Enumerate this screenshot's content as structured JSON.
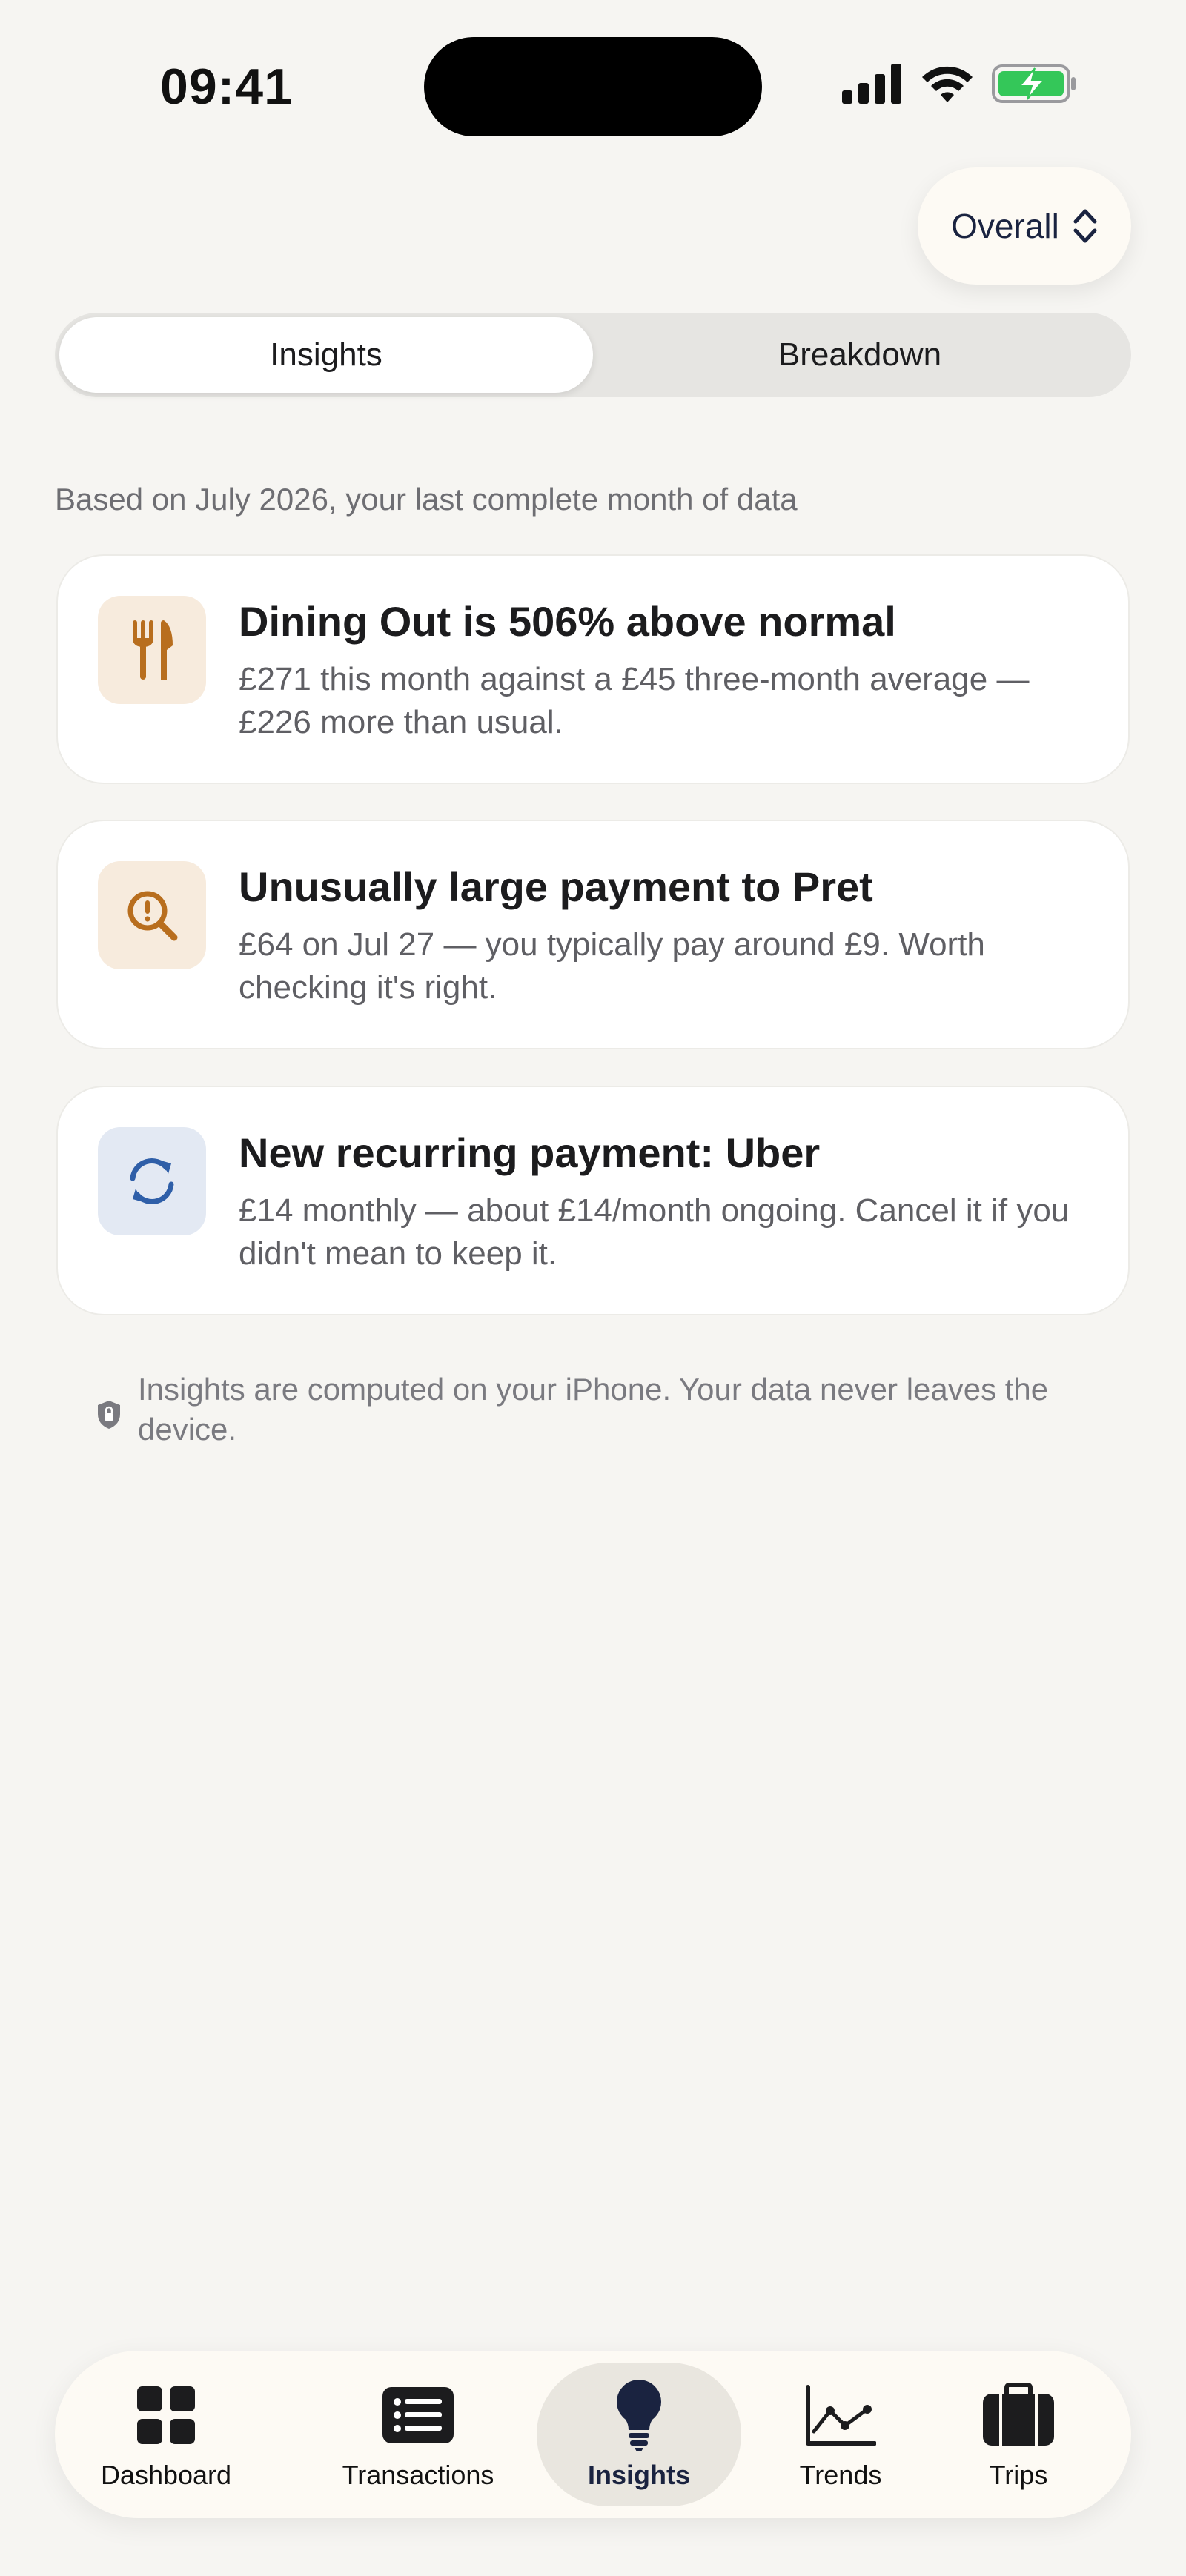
{
  "status_bar": {
    "time": "09:41"
  },
  "scope_picker": {
    "label": "Overall"
  },
  "segmented": {
    "tabs": [
      {
        "label": "Insights",
        "active": true
      },
      {
        "label": "Breakdown",
        "active": false
      }
    ]
  },
  "based_on": "Based on July 2026, your last complete month of data",
  "insights": [
    {
      "icon": "fork-knife-icon",
      "title": "Dining Out is 506% above normal",
      "body": "£271 this month against a £45 three-month average — £226 more than usual."
    },
    {
      "icon": "magnifier-alert-icon",
      "title": "Unusually large payment to Pret",
      "body": "£64 on Jul 27 — you typically pay around £9. Worth checking it's right."
    },
    {
      "icon": "recurring-arrows-icon",
      "title": "New recurring payment: Uber",
      "body": "£14 monthly — about £14/month ongoing. Cancel it if you didn't mean to keep it."
    }
  ],
  "privacy_note": "Insights are computed on your iPhone. Your data never leaves the device.",
  "tabbar": {
    "items": [
      {
        "label": "Dashboard",
        "icon": "dashboard-grid-icon",
        "active": false
      },
      {
        "label": "Transactions",
        "icon": "list-icon",
        "active": false
      },
      {
        "label": "Insights",
        "icon": "lightbulb-icon",
        "active": true
      },
      {
        "label": "Trends",
        "icon": "line-chart-icon",
        "active": false
      },
      {
        "label": "Trips",
        "icon": "suitcase-icon",
        "active": false
      }
    ]
  },
  "colors": {
    "background": "#f6f5f2",
    "accent_orange": "#b86e1e",
    "accent_orange_bg": "#f7ebdd",
    "accent_blue": "#2f5fa8",
    "accent_blue_bg": "#e3e9f3",
    "navy": "#1a2340",
    "battery_green": "#34c759"
  }
}
